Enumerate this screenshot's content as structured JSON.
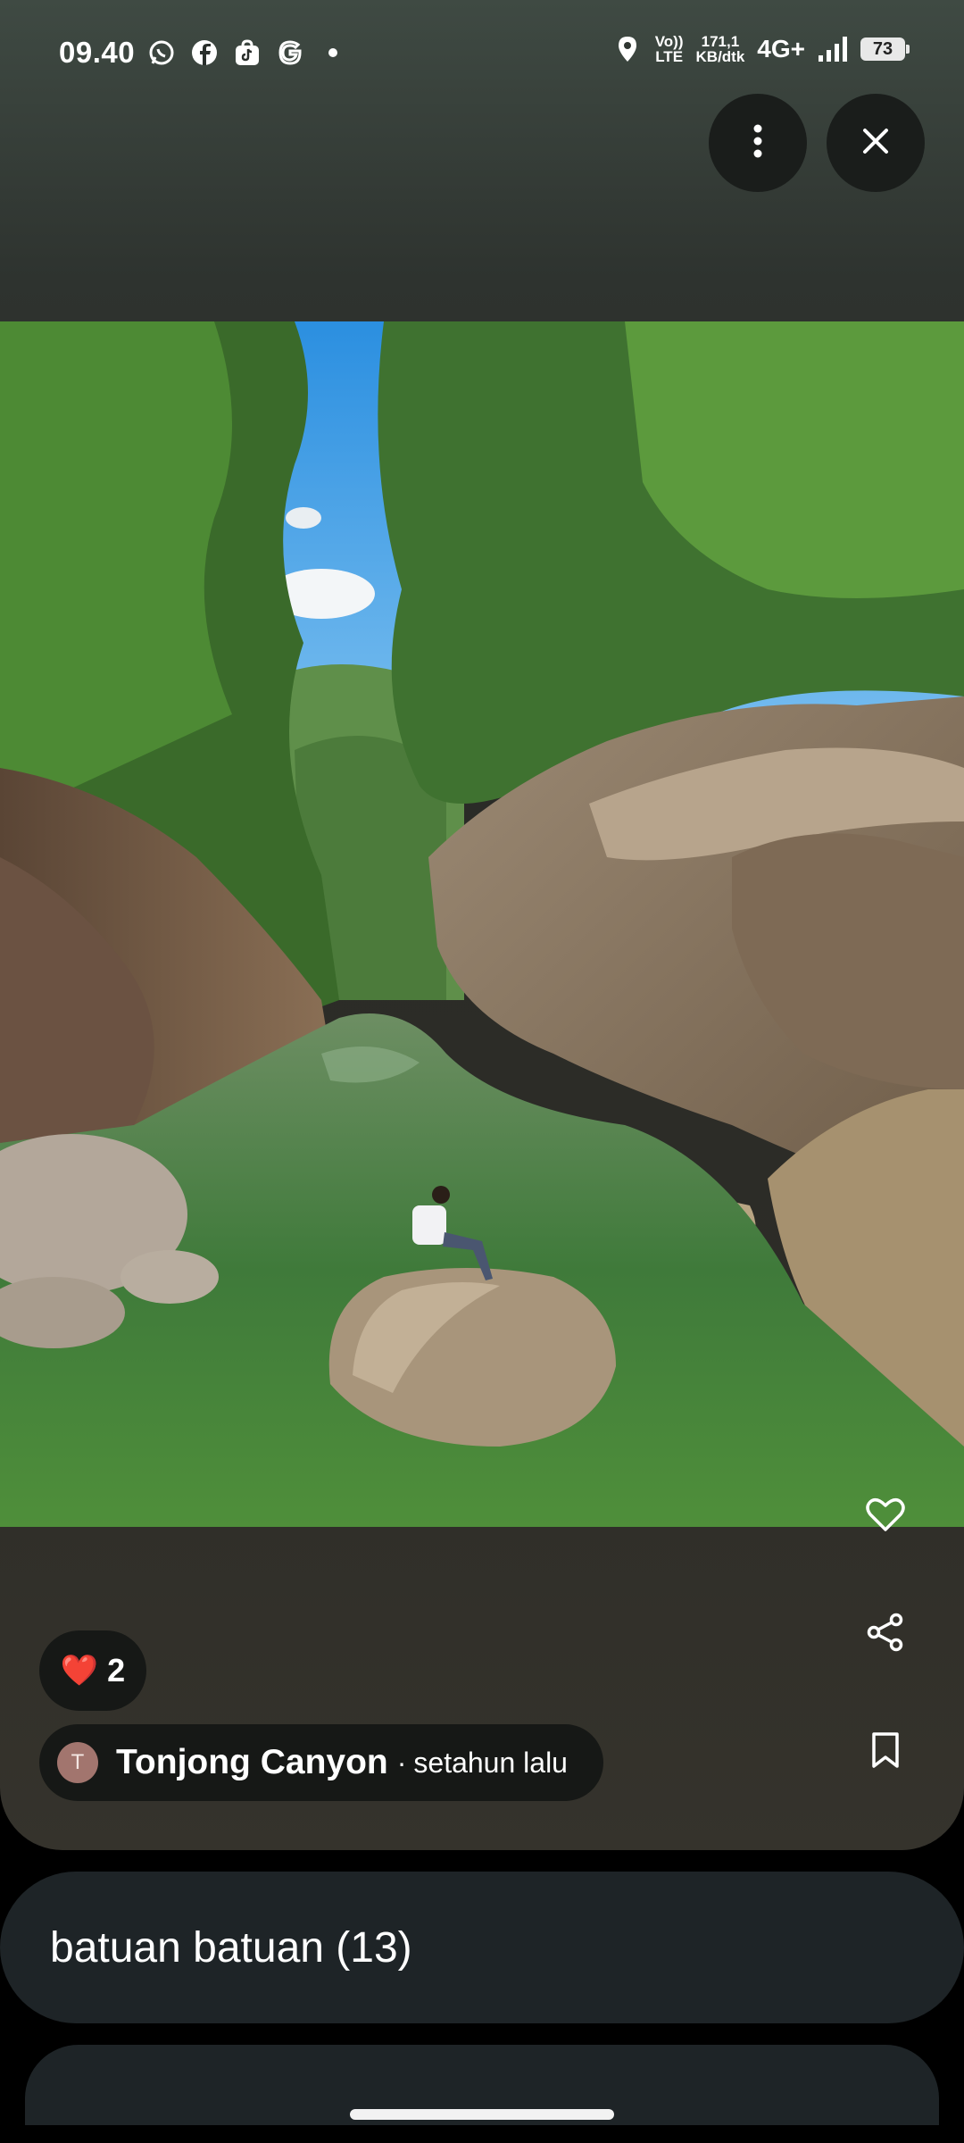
{
  "status_bar": {
    "time": "09.40",
    "net_speed_top": "171,1",
    "net_speed_bottom": "KB/dtk",
    "volte_top": "Vo))",
    "volte_bottom": "LTE",
    "network_type": "4G+",
    "battery": "73",
    "icons_left": [
      "whatsapp-icon",
      "facebook-icon",
      "tiktok-icon",
      "google-icon",
      "dot-icon"
    ],
    "icons_right": [
      "location-icon",
      "signal-icon",
      "battery-icon"
    ]
  },
  "top_actions": {
    "more_icon": "more-vertical-icon",
    "close_icon": "close-icon"
  },
  "photo": {
    "subject": "canyon-river-photo"
  },
  "side_actions": {
    "like_icon": "heart-outline-icon",
    "share_icon": "share-icon",
    "save_icon": "bookmark-icon"
  },
  "reaction": {
    "emoji": "❤️",
    "count": "2"
  },
  "place": {
    "avatar_initial": "T",
    "name": "Tonjong Canyon",
    "separator": "·",
    "time_ago": "setahun lalu"
  },
  "album": {
    "title": "batuan batuan (13)"
  },
  "colors": {
    "card_bg": "#1e2427",
    "chip_bg": "#161816",
    "avatar_bg": "#a2756e"
  }
}
